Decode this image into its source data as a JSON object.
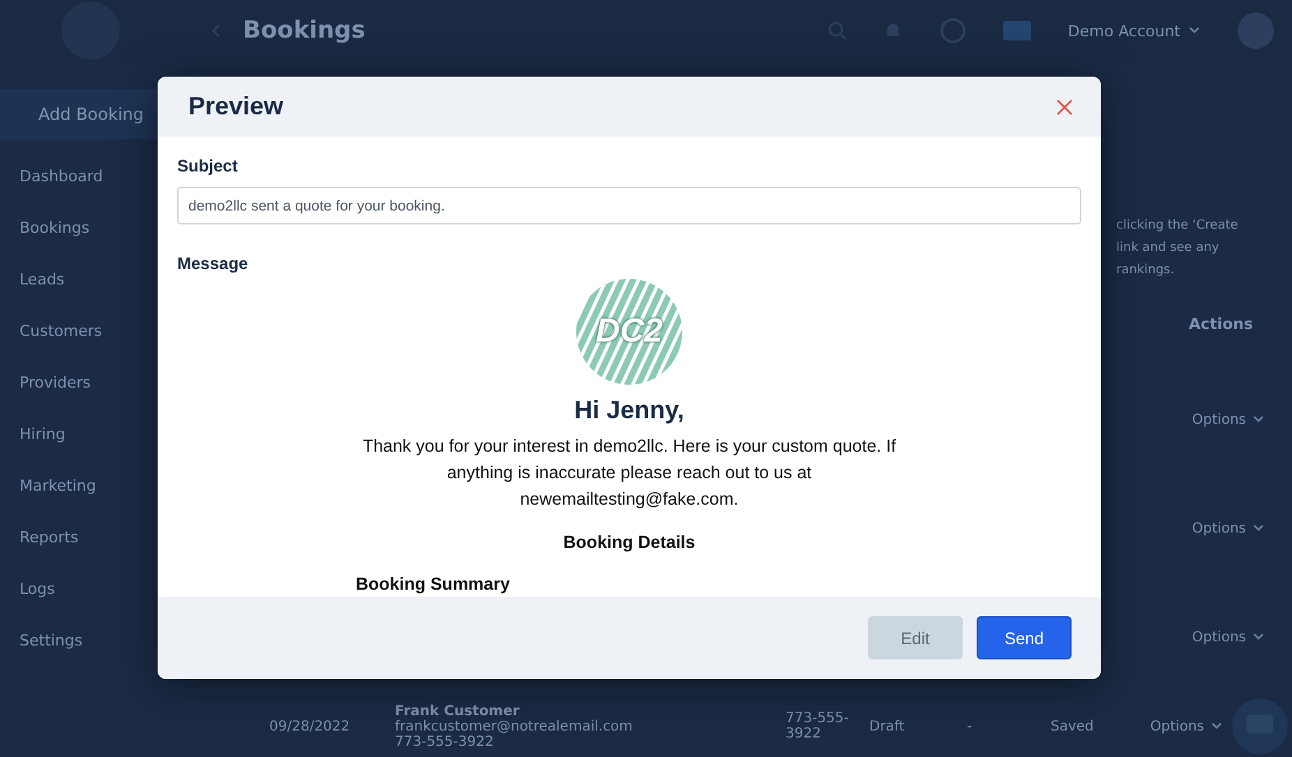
{
  "header": {
    "title": "Bookings",
    "account": "Demo Account"
  },
  "sidebar": {
    "add_button": "Add Booking",
    "items": [
      {
        "label": "Dashboard"
      },
      {
        "label": "Bookings"
      },
      {
        "label": "Leads"
      },
      {
        "label": "Customers"
      },
      {
        "label": "Providers"
      },
      {
        "label": "Hiring"
      },
      {
        "label": "Marketing"
      },
      {
        "label": "Reports"
      },
      {
        "label": "Logs"
      },
      {
        "label": "Settings"
      }
    ]
  },
  "page": {
    "intro_lines": [
      "clicking the ‘Create",
      "link and see any",
      "rankings."
    ],
    "table": {
      "actions_heading": "Actions",
      "rows": [
        {
          "action": "Options"
        },
        {
          "action": "Options"
        },
        {
          "action": "Options"
        },
        {
          "date": "09/28/2022",
          "customer": "Frank Customer",
          "email": "frankcustomer@notrealemail.com",
          "phone": "773-555-3922",
          "phone_column": "773-555-3922",
          "status": "Draft",
          "column_7": "-",
          "column_8": "Saved",
          "action": "Options"
        }
      ]
    }
  },
  "modal": {
    "title": "Preview",
    "subject_label": "Subject",
    "subject_value": "demo2llc sent a quote for your booking.",
    "message_label": "Message",
    "email": {
      "logo_text": "DC2",
      "greeting": "Hi Jenny,",
      "body": "Thank you for your interest in demo2llc. Here is your custom quote. If anything is inaccurate please reach out to us at newemailtesting@fake.com.",
      "section_heading": "Booking Details",
      "subheading": "Booking Summary"
    },
    "buttons": [
      {
        "label": "Edit",
        "kind": "secondary"
      },
      {
        "label": "Send",
        "kind": "primary"
      }
    ]
  }
}
